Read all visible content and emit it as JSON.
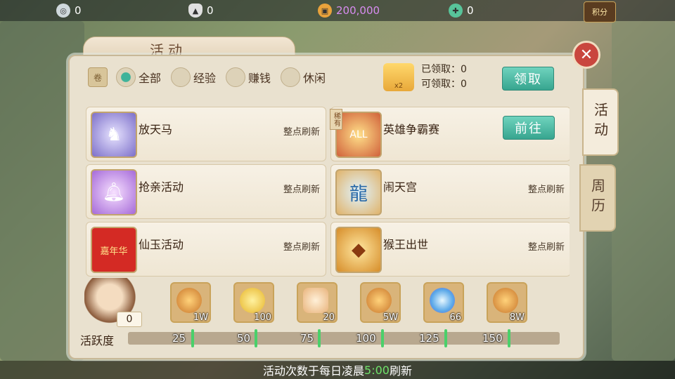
{
  "currencies": [
    {
      "icon": "silver-medal-icon",
      "value": "0",
      "color": "#cfd8dc"
    },
    {
      "icon": "silver-ingot-icon",
      "value": "0",
      "color": "#e0e0e0"
    },
    {
      "icon": "copper-coin-icon",
      "value": "200,000",
      "color": "#e9a23b",
      "text_color": "#d88cf0"
    },
    {
      "icon": "jade-icon",
      "value": "0",
      "color": "#58c49a"
    }
  ],
  "score_button": {
    "label": "积分"
  },
  "panel": {
    "title": "活动"
  },
  "filters": [
    {
      "label": "全部",
      "selected": true
    },
    {
      "label": "经验",
      "selected": false
    },
    {
      "label": "赚钱",
      "selected": false
    },
    {
      "label": "休闲",
      "selected": false
    }
  ],
  "claim": {
    "claimed_label": "已领取：0",
    "available_label": "可领取：0",
    "button_label": "领取",
    "badge": "x2"
  },
  "activities": [
    {
      "name": "放天马",
      "note": "整点刷新",
      "icon": "pegasus-icon",
      "rare": false,
      "go": false
    },
    {
      "name": "英雄争霸赛",
      "note": "",
      "icon": "hero-contest-icon",
      "rare": true,
      "rare_label": "稀有",
      "go": true,
      "go_label": "前往"
    },
    {
      "name": "抢亲活动",
      "note": "整点刷新",
      "icon": "bell-icon",
      "rare": false,
      "go": false
    },
    {
      "name": "闹天宫",
      "note": "整点刷新",
      "icon": "dragon-icon",
      "rare": false,
      "go": false
    },
    {
      "name": "仙玉活动",
      "note": "整点刷新",
      "icon": "red-envelope-icon",
      "rare": false,
      "go": false,
      "icon_text": "嘉年华"
    },
    {
      "name": "猴王出世",
      "note": "整点刷新",
      "icon": "treasure-icon",
      "rare": false,
      "go": false
    }
  ],
  "side_tabs": [
    {
      "label": "活动",
      "active": true
    },
    {
      "label": "周历",
      "active": false
    }
  ],
  "mascot_count": "0",
  "rewards": [
    {
      "icon": "copper-coin-icon",
      "value": "1W"
    },
    {
      "icon": "gold-flower-icon",
      "value": "100"
    },
    {
      "icon": "scroll-icon",
      "value": "20"
    },
    {
      "icon": "copper-coin-icon",
      "value": "5W"
    },
    {
      "icon": "crystal-orb-icon",
      "value": "66"
    },
    {
      "icon": "copper-coin-icon",
      "value": "8W"
    }
  ],
  "activity_label": "活跃度",
  "milestones": [
    "25",
    "50",
    "75",
    "100",
    "125",
    "150"
  ],
  "activity_progress": 0,
  "bottom_note": {
    "prefix": "活动次数于每日凌晨",
    "time": "5:00",
    "suffix": "刷新"
  }
}
